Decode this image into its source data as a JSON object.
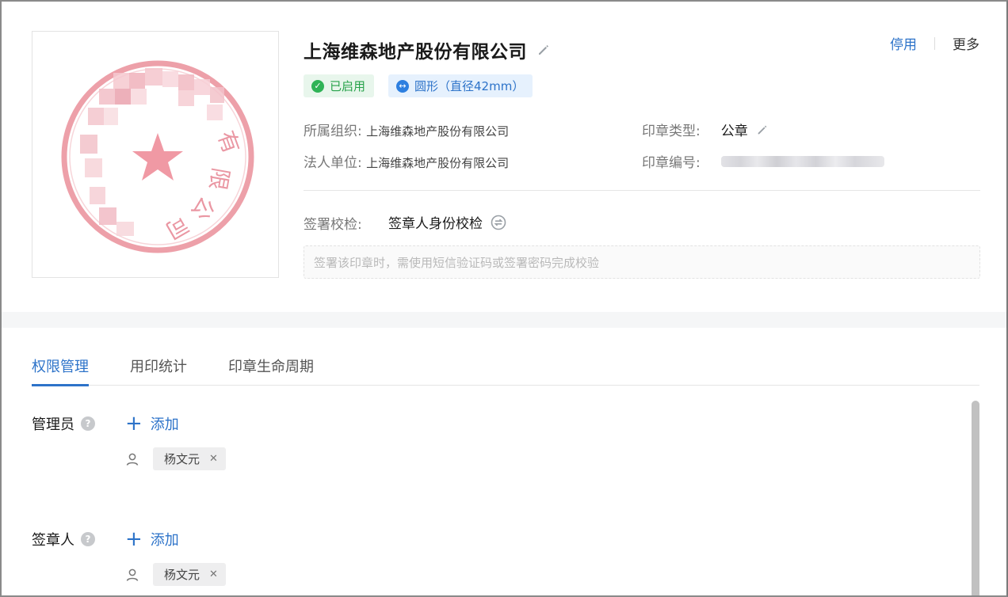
{
  "seal": {
    "title": "上海维森地产股份有限公司",
    "chars_right": [
      "有",
      "限",
      "公",
      "司"
    ],
    "brand_color": "#e8909a"
  },
  "header": {
    "title": "上海维森地产股份有限公司",
    "edit_icon": "pencil-icon",
    "actions": {
      "disable": "停用",
      "more": "更多"
    },
    "badges": {
      "status": "已启用",
      "shape": "圆形（直径42mm）"
    }
  },
  "info": {
    "org_label": "所属组织:",
    "org_value": "上海维森地产股份有限公司",
    "legal_label": "法人单位:",
    "legal_value": "上海维森地产股份有限公司",
    "type_label": "印章类型:",
    "type_value": "公章",
    "code_label": "印章编号:"
  },
  "verify": {
    "label": "签署校检:",
    "value": "签章人身份校检",
    "hint": "签署该印章时，需使用短信验证码或签署密码完成校验"
  },
  "tabs": [
    {
      "label": "权限管理",
      "active": true
    },
    {
      "label": "用印统计",
      "active": false
    },
    {
      "label": "印章生命周期",
      "active": false
    }
  ],
  "sections": {
    "admins": {
      "label": "管理员",
      "add": "添加",
      "users": [
        "杨文元"
      ]
    },
    "signers": {
      "label": "签章人",
      "add": "添加",
      "users": [
        "杨文元"
      ]
    }
  },
  "colors": {
    "accent": "#2d73c9",
    "success": "#27a24a",
    "seal_red": "#e8909a"
  }
}
